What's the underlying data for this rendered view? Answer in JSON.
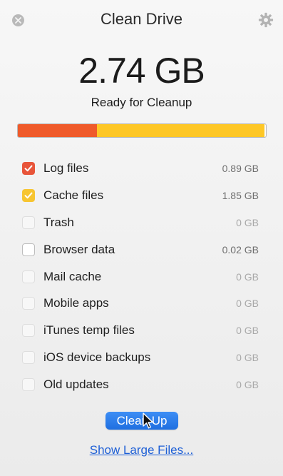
{
  "window": {
    "title": "Clean Drive"
  },
  "summary": {
    "size": "2.74 GB",
    "status": "Ready for Cleanup"
  },
  "usage_bar": {
    "segments": [
      {
        "name": "Log files",
        "fraction": 0.32,
        "color": "#ef5a2a"
      },
      {
        "name": "Cache files",
        "fraction": 0.675,
        "color": "#fec726"
      }
    ]
  },
  "items": [
    {
      "label": "Log files",
      "amount": "0.89 GB",
      "checked": true,
      "check_color": "#e8553a"
    },
    {
      "label": "Cache files",
      "amount": "1.85 GB",
      "checked": true,
      "check_color": "#f7c531"
    },
    {
      "label": "Trash",
      "amount": "0 GB",
      "checked": false,
      "disabled": true
    },
    {
      "label": "Browser data",
      "amount": "0.02 GB",
      "checked": false,
      "disabled": false
    },
    {
      "label": "Mail cache",
      "amount": "0 GB",
      "checked": false,
      "disabled": true
    },
    {
      "label": "Mobile apps",
      "amount": "0 GB",
      "checked": false,
      "disabled": true
    },
    {
      "label": "iTunes temp files",
      "amount": "0 GB",
      "checked": false,
      "disabled": true
    },
    {
      "label": "iOS device backups",
      "amount": "0 GB",
      "checked": false,
      "disabled": true
    },
    {
      "label": "Old updates",
      "amount": "0 GB",
      "checked": false,
      "disabled": true
    }
  ],
  "actions": {
    "clean_label": "Clean Up",
    "large_files_label": "Show Large Files..."
  },
  "icons": {
    "close": "close-icon",
    "settings": "gear-icon",
    "checkmark": "checkmark-icon",
    "cursor": "pointer-cursor-icon"
  }
}
